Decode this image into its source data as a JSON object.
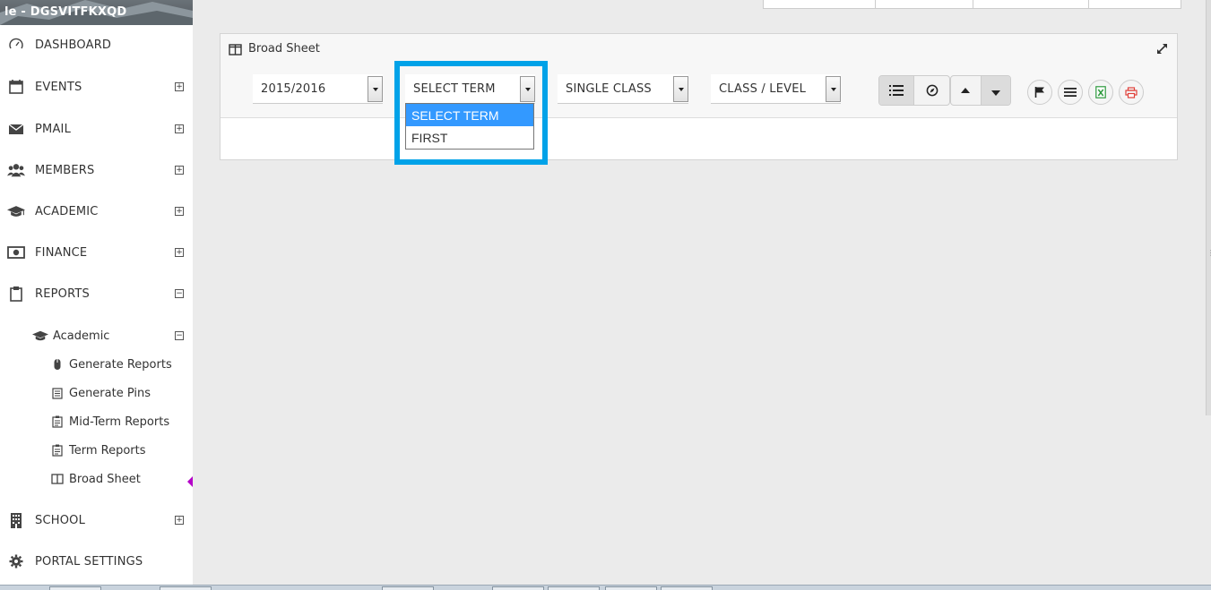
{
  "brand": {
    "text": "le - DGSVITFKXQD"
  },
  "sidebar": {
    "items": [
      {
        "key": "dashboard",
        "label": "DASHBOARD",
        "expander": ""
      },
      {
        "key": "events",
        "label": "EVENTS",
        "expander": "+"
      },
      {
        "key": "pmail",
        "label": "PMAIL",
        "expander": "+"
      },
      {
        "key": "members",
        "label": "MEMBERS",
        "expander": "+"
      },
      {
        "key": "academic",
        "label": "ACADEMIC",
        "expander": "+"
      },
      {
        "key": "finance",
        "label": "FINANCE",
        "expander": "+"
      },
      {
        "key": "reports",
        "label": "REPORTS",
        "expander": "−"
      },
      {
        "key": "school",
        "label": "SCHOOL",
        "expander": "+"
      },
      {
        "key": "portal-settings",
        "label": "PORTAL SETTINGS",
        "expander": ""
      }
    ],
    "reports_sub": {
      "label": "Academic",
      "expander": "−",
      "children": [
        {
          "label": "Generate Reports"
        },
        {
          "label": "Generate Pins"
        },
        {
          "label": "Mid-Term Reports"
        },
        {
          "label": "Term Reports"
        },
        {
          "label": "Broad Sheet",
          "active": true
        }
      ]
    }
  },
  "panel": {
    "title": "Broad Sheet",
    "filters": {
      "session": "2015/2016",
      "term": "SELECT TERM",
      "mode": "SINGLE CLASS",
      "class_level": "CLASS / LEVEL"
    },
    "term_dropdown": {
      "options": [
        "SELECT TERM",
        "FIRST"
      ],
      "highlighted": "SELECT TERM"
    }
  },
  "colors": {
    "highlight_border": "#00a2e8",
    "dropdown_selected": "#3399ff",
    "active_marker": "#b400c8",
    "excel_icon": "#2e9a3e",
    "print_icon": "#e0403a"
  }
}
